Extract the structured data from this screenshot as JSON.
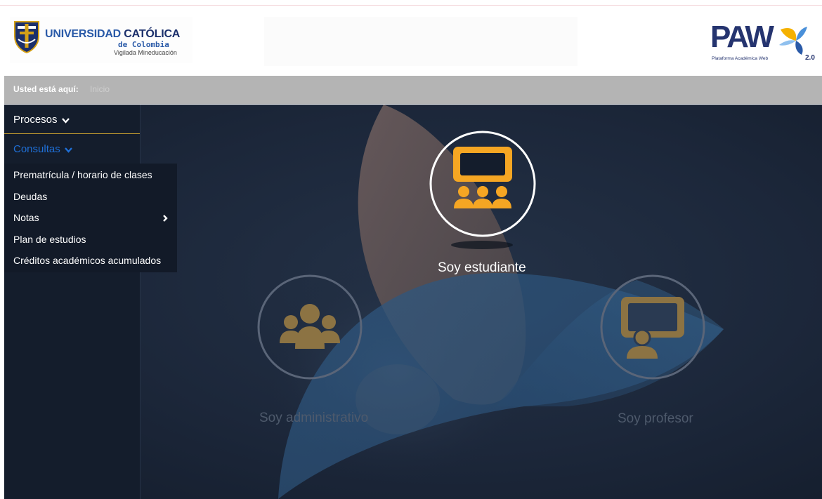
{
  "header": {
    "university_name_part1": "UNIVERSIDAD",
    "university_name_part2": "CATÓLICA",
    "university_sub": "de Colombia",
    "university_vigilada": "Vigilada Mineducación",
    "paw_logo": "PAW",
    "paw_subtitle": "Plataforma Académica Web",
    "paw_version": "2.0"
  },
  "breadcrumb": {
    "label": "Usted está aquí:",
    "current": "Inicio"
  },
  "sidebar": {
    "procesos": "Procesos",
    "consultas": "Consultas",
    "submenu": [
      {
        "label": "Prematrícula / horario de clases"
      },
      {
        "label": "Deudas"
      },
      {
        "label": "Notas"
      },
      {
        "label": "Plan de estudios"
      },
      {
        "label": "Créditos académicos acumulados"
      }
    ]
  },
  "roles": {
    "student": "Soy estudiante",
    "admin": "Soy administrativo",
    "teacher": "Soy profesor"
  },
  "colors": {
    "accent": "#f5a623",
    "link_active": "#1f6fd6",
    "brand_blue": "#25346f",
    "sidebar_bg": "#141d2c"
  },
  "icons": {
    "student": "classroom-icon",
    "admin": "group-icon",
    "teacher": "teacher-board-icon",
    "chevron": "chevron-down-icon",
    "submenu_arrow": "chevron-right-icon"
  }
}
